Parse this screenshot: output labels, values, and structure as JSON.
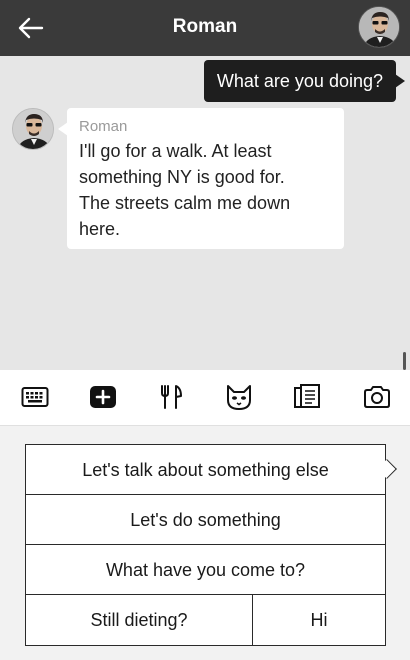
{
  "header": {
    "title": "Roman",
    "back_icon": "arrow-left-icon",
    "avatar_icon": "contact-avatar"
  },
  "chat": {
    "outgoing": [
      {
        "text": "What are you doing?"
      }
    ],
    "incoming": [
      {
        "sender": "Roman",
        "lines": [
          "I'll go for a walk. At least",
          "something NY is good for.",
          "The streets calm me down",
          "here."
        ]
      }
    ]
  },
  "toolbar": {
    "tools": [
      {
        "icon": "keyboard-icon"
      },
      {
        "icon": "add-icon",
        "selected": true
      },
      {
        "icon": "fork-knife-icon"
      },
      {
        "icon": "cat-icon"
      },
      {
        "icon": "book-icon"
      },
      {
        "icon": "camera-icon"
      }
    ]
  },
  "quick_replies": [
    {
      "label": "Let's talk about something else"
    },
    {
      "label": "Let's do something"
    },
    {
      "label": "What have you come to?"
    },
    {
      "label": "Still dieting?"
    },
    {
      "label": "Hi"
    }
  ],
  "colors": {
    "header_bg": "#3a3a3a",
    "chat_bg": "#e6e6e6",
    "outgoing_bubble": "#1e1e1e",
    "incoming_bubble": "#ffffff",
    "sender_name": "#9a9a9a"
  }
}
